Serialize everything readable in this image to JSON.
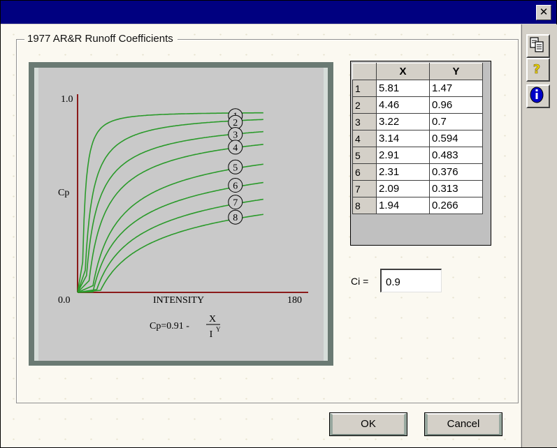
{
  "window": {
    "close_label": "✕"
  },
  "group_title": "1977 AR&R Runoff Coefficients",
  "chart": {
    "y_top": "1.0",
    "y_bottom": "0.0",
    "y_label": "Cp",
    "x_label": "INTENSITY",
    "x_max": "180",
    "formula_left": "Cp=0.91 -",
    "formula_num": "X",
    "formula_den": "I",
    "formula_exp": "Y"
  },
  "table": {
    "headers": [
      "X",
      "Y"
    ],
    "rows": [
      {
        "n": "1",
        "x": "5.81",
        "y": "1.47"
      },
      {
        "n": "2",
        "x": "4.46",
        "y": "0.96"
      },
      {
        "n": "3",
        "x": "3.22",
        "y": "0.7"
      },
      {
        "n": "4",
        "x": "3.14",
        "y": "0.594"
      },
      {
        "n": "5",
        "x": "2.91",
        "y": "0.483"
      },
      {
        "n": "6",
        "x": "2.31",
        "y": "0.376"
      },
      {
        "n": "7",
        "x": "2.09",
        "y": "0.313"
      },
      {
        "n": "8",
        "x": "1.94",
        "y": "0.266"
      }
    ]
  },
  "ci": {
    "label": "Ci =",
    "value": "0.9"
  },
  "buttons": {
    "ok": "OK",
    "cancel": "Cancel"
  },
  "sidebar_icons": [
    "copy-icon",
    "help-icon",
    "info-icon"
  ],
  "colors": {
    "title_bar": "#000080",
    "curve": "#2a9a2a",
    "axis": "#8b1a1a"
  }
}
